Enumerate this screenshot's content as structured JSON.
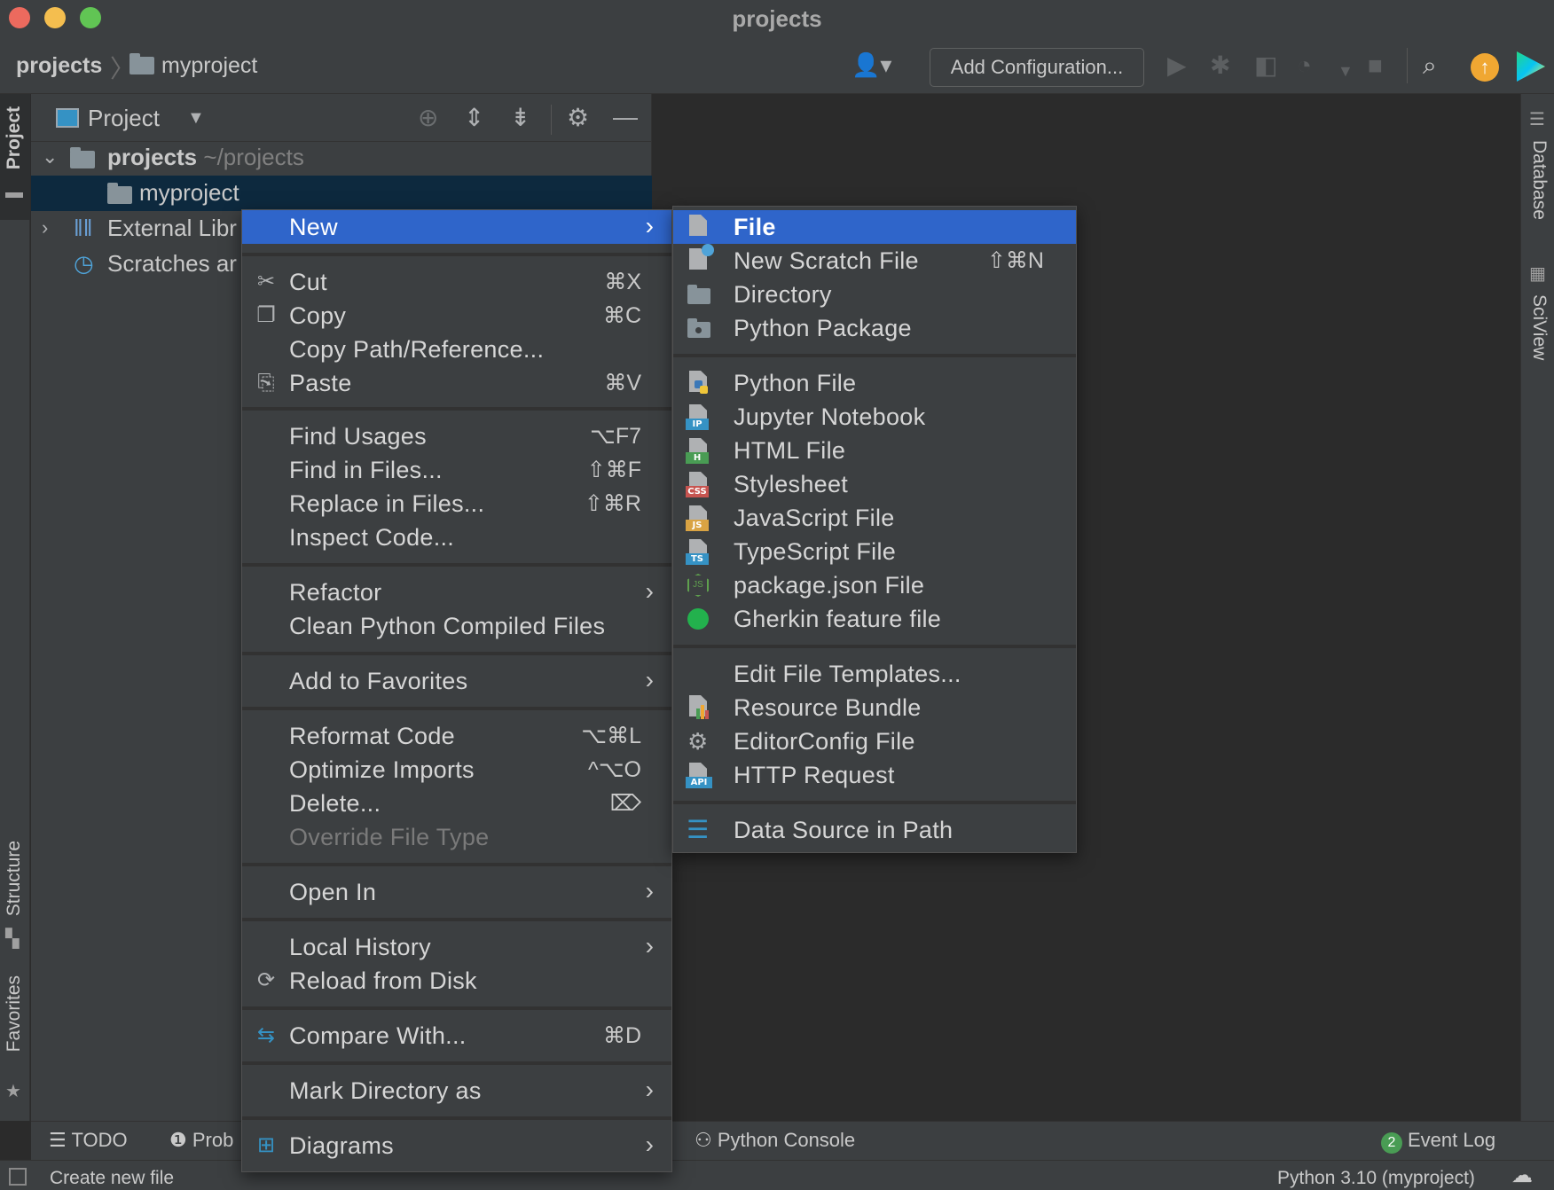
{
  "window": {
    "title": "projects"
  },
  "breadcrumb": {
    "root": "projects",
    "separator": "〉",
    "child": "myproject"
  },
  "toolbar": {
    "add_configuration": "Add Configuration..."
  },
  "left_stripe": {
    "project": "Project",
    "structure": "Structure",
    "favorites": "Favorites"
  },
  "right_stripe": {
    "database": "Database",
    "sciview": "SciView"
  },
  "project_panel": {
    "title": "Project",
    "tree": [
      {
        "label": "projects",
        "hint": "~/projects"
      },
      {
        "label": "myproject"
      },
      {
        "label": "External Libr"
      },
      {
        "label": "Scratches ar"
      }
    ]
  },
  "context_menu": {
    "items": [
      {
        "label": "New",
        "shortcut": "",
        "submenu": true,
        "highlighted": true
      },
      {
        "label": "Cut",
        "shortcut": "⌘X",
        "icon": "scissors-icon"
      },
      {
        "label": "Copy",
        "shortcut": "⌘C",
        "icon": "copy-icon"
      },
      {
        "label": "Copy Path/Reference...",
        "shortcut": ""
      },
      {
        "label": "Paste",
        "shortcut": "⌘V",
        "icon": "clipboard-icon"
      },
      {
        "label": "Find Usages",
        "shortcut": "⌥F7"
      },
      {
        "label": "Find in Files...",
        "shortcut": "⇧⌘F"
      },
      {
        "label": "Replace in Files...",
        "shortcut": "⇧⌘R"
      },
      {
        "label": "Inspect Code...",
        "shortcut": ""
      },
      {
        "label": "Refactor",
        "submenu": true
      },
      {
        "label": "Clean Python Compiled Files",
        "shortcut": ""
      },
      {
        "label": "Add to Favorites",
        "submenu": true
      },
      {
        "label": "Reformat Code",
        "shortcut": "⌥⌘L"
      },
      {
        "label": "Optimize Imports",
        "shortcut": "^⌥O"
      },
      {
        "label": "Delete...",
        "shortcut": "⌦"
      },
      {
        "label": "Override File Type",
        "disabled": true
      },
      {
        "label": "Open In",
        "submenu": true
      },
      {
        "label": "Local History",
        "submenu": true
      },
      {
        "label": "Reload from Disk",
        "icon": "reload-icon"
      },
      {
        "label": "Compare With...",
        "shortcut": "⌘D",
        "icon": "compare-icon"
      },
      {
        "label": "Mark Directory as",
        "submenu": true
      },
      {
        "label": "Diagrams",
        "submenu": true,
        "icon": "diagram-icon"
      }
    ]
  },
  "new_submenu": {
    "items": [
      {
        "label": "File",
        "highlighted": true
      },
      {
        "label": "New Scratch File",
        "shortcut": "⇧⌘N"
      },
      {
        "label": "Directory"
      },
      {
        "label": "Python Package"
      },
      {
        "label": "Python File"
      },
      {
        "label": "Jupyter Notebook",
        "tag": "IP"
      },
      {
        "label": "HTML File",
        "tag": "H"
      },
      {
        "label": "Stylesheet",
        "tag": "CSS"
      },
      {
        "label": "JavaScript File",
        "tag": "JS"
      },
      {
        "label": "TypeScript File",
        "tag": "TS"
      },
      {
        "label": "package.json File",
        "tag": "JS"
      },
      {
        "label": "Gherkin feature file"
      },
      {
        "label": "Edit File Templates..."
      },
      {
        "label": "Resource Bundle"
      },
      {
        "label": "EditorConfig File"
      },
      {
        "label": "HTTP Request",
        "tag": "API"
      },
      {
        "label": "Data Source in Path"
      }
    ]
  },
  "bottom_tools": {
    "todo": "TODO",
    "problems": "Prob",
    "python_console": "Python Console",
    "event_log": "Event Log",
    "event_count": "2"
  },
  "status_bar": {
    "message": "Create new file",
    "interpreter": "Python 3.10 (myproject)"
  },
  "colors": {
    "highlight": "#2f65ca",
    "panel": "#3c3f41",
    "editor": "#2b2b2b",
    "selection": "#0d293e"
  }
}
